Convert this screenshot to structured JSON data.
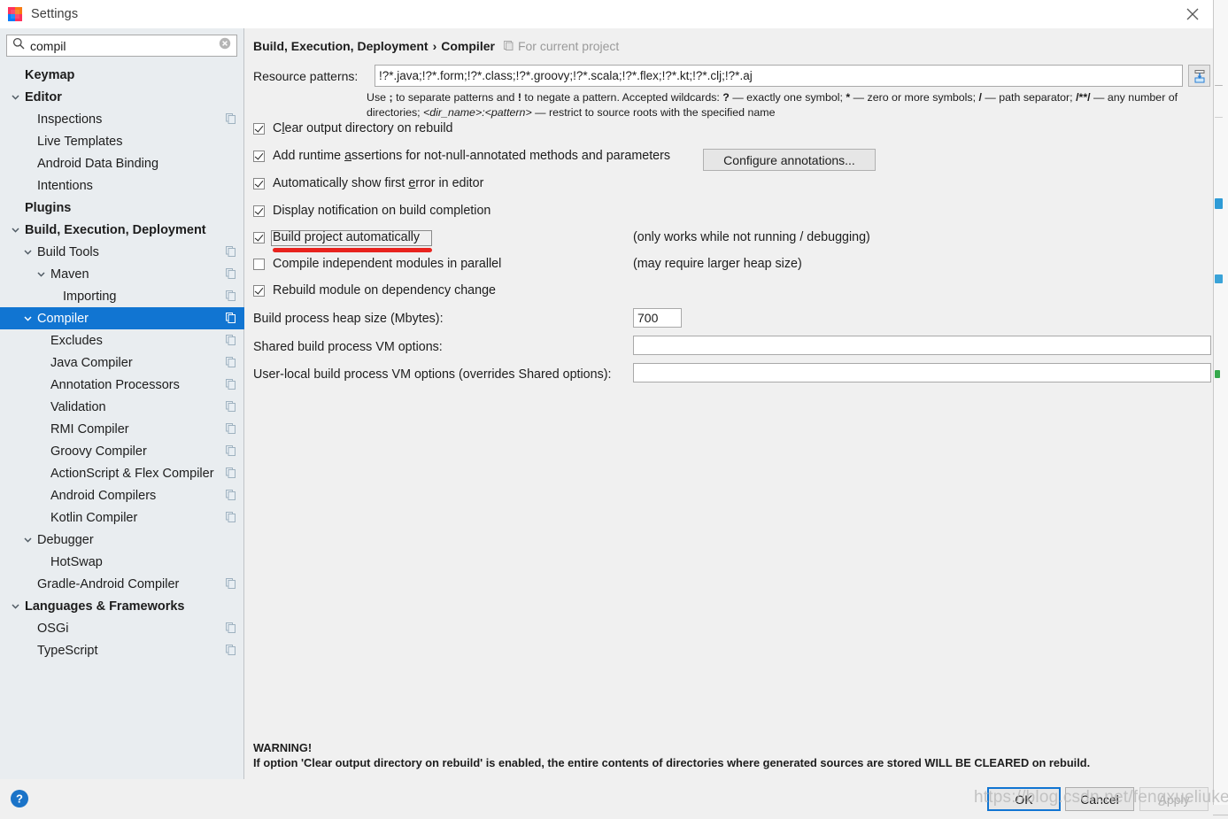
{
  "window": {
    "title": "Settings",
    "app_icon": "intellij-idea-icon",
    "close_icon": "close-icon"
  },
  "search": {
    "icon": "search-icon",
    "value": "compil",
    "placeholder": "",
    "clear_icon": "clear-icon"
  },
  "sidebar": {
    "items": [
      {
        "label": "Keymap",
        "indent": 28,
        "bold": true,
        "twisty": "none",
        "endicon": false,
        "selected": false
      },
      {
        "label": "Editor",
        "indent": 28,
        "bold": true,
        "twisty": "expanded",
        "endicon": false,
        "selected": false
      },
      {
        "label": "Inspections",
        "indent": 42,
        "bold": false,
        "twisty": "none",
        "endicon": true,
        "selected": false
      },
      {
        "label": "Live Templates",
        "indent": 42,
        "bold": false,
        "twisty": "none",
        "endicon": false,
        "selected": false
      },
      {
        "label": "Android Data Binding",
        "indent": 42,
        "bold": false,
        "twisty": "none",
        "endicon": false,
        "selected": false
      },
      {
        "label": "Intentions",
        "indent": 42,
        "bold": false,
        "twisty": "none",
        "endicon": false,
        "selected": false
      },
      {
        "label": "Plugins",
        "indent": 28,
        "bold": true,
        "twisty": "none",
        "endicon": false,
        "selected": false
      },
      {
        "label": "Build, Execution, Deployment",
        "indent": 28,
        "bold": true,
        "twisty": "expanded",
        "endicon": false,
        "selected": false
      },
      {
        "label": "Build Tools",
        "indent": 42,
        "bold": false,
        "twisty": "expanded",
        "endicon": true,
        "selected": false
      },
      {
        "label": "Maven",
        "indent": 57,
        "bold": false,
        "twisty": "expanded",
        "endicon": true,
        "selected": false
      },
      {
        "label": "Importing",
        "indent": 71,
        "bold": false,
        "twisty": "none",
        "endicon": true,
        "selected": false
      },
      {
        "label": "Compiler",
        "indent": 42,
        "bold": false,
        "twisty": "expanded",
        "endicon": true,
        "selected": true
      },
      {
        "label": "Excludes",
        "indent": 57,
        "bold": false,
        "twisty": "none",
        "endicon": true,
        "selected": false
      },
      {
        "label": "Java Compiler",
        "indent": 57,
        "bold": false,
        "twisty": "none",
        "endicon": true,
        "selected": false
      },
      {
        "label": "Annotation Processors",
        "indent": 57,
        "bold": false,
        "twisty": "none",
        "endicon": true,
        "selected": false
      },
      {
        "label": "Validation",
        "indent": 57,
        "bold": false,
        "twisty": "none",
        "endicon": true,
        "selected": false
      },
      {
        "label": "RMI Compiler",
        "indent": 57,
        "bold": false,
        "twisty": "none",
        "endicon": true,
        "selected": false
      },
      {
        "label": "Groovy Compiler",
        "indent": 57,
        "bold": false,
        "twisty": "none",
        "endicon": true,
        "selected": false
      },
      {
        "label": "ActionScript & Flex Compiler",
        "indent": 57,
        "bold": false,
        "twisty": "none",
        "endicon": true,
        "selected": false
      },
      {
        "label": "Android Compilers",
        "indent": 57,
        "bold": false,
        "twisty": "none",
        "endicon": true,
        "selected": false
      },
      {
        "label": "Kotlin Compiler",
        "indent": 57,
        "bold": false,
        "twisty": "none",
        "endicon": true,
        "selected": false
      },
      {
        "label": "Debugger",
        "indent": 42,
        "bold": false,
        "twisty": "expanded",
        "endicon": false,
        "selected": false
      },
      {
        "label": "HotSwap",
        "indent": 57,
        "bold": false,
        "twisty": "none",
        "endicon": false,
        "selected": false
      },
      {
        "label": "Gradle-Android Compiler",
        "indent": 42,
        "bold": false,
        "twisty": "none",
        "endicon": true,
        "selected": false
      },
      {
        "label": "Languages & Frameworks",
        "indent": 28,
        "bold": true,
        "twisty": "expanded",
        "endicon": false,
        "selected": false
      },
      {
        "label": "OSGi",
        "indent": 42,
        "bold": false,
        "twisty": "none",
        "endicon": true,
        "selected": false
      },
      {
        "label": "TypeScript",
        "indent": 42,
        "bold": false,
        "twisty": "none",
        "endicon": true,
        "selected": false
      }
    ]
  },
  "main": {
    "breadcrumb": {
      "parent": "Build, Execution, Deployment",
      "separator": "›",
      "current": "Compiler",
      "scope_icon": "project-scope-icon",
      "scope_label": "For current project"
    },
    "resource_patterns": {
      "label": "Resource patterns:",
      "value": "!?*.java;!?*.form;!?*.class;!?*.groovy;!?*.scala;!?*.flex;!?*.kt;!?*.clj;!?*.aj",
      "placeholder": "",
      "expand_icon": "insert-expand-icon",
      "help_line1_a": "Use ",
      "help_semicolon": ";",
      "help_line1_b": " to separate patterns and ",
      "help_bang": "!",
      "help_line1_c": " to negate a pattern. Accepted wildcards: ",
      "help_q": "?",
      "help_line1_d": " — exactly one symbol; ",
      "help_star": "*",
      "help_line1_e": " — zero or more symbols; ",
      "help_slash": "/",
      "help_line1_f": " — path separator; ",
      "help_globstar": "/**/",
      "help_line1_g": " —",
      "help_line2_a": "any number of directories; ",
      "help_dirname": "<dir_name>",
      "help_colon": ":",
      "help_pattern": "<pattern>",
      "help_line2_b": " — restrict to source roots with the specified name"
    },
    "checkboxes": [
      {
        "label_pre": "C",
        "label_mnemonic": "l",
        "label_post": "ear output directory on rebuild",
        "checked": true,
        "hint": ""
      },
      {
        "label_pre": "Add runtime ",
        "label_mnemonic": "a",
        "label_post": "ssertions for not-null-annotated methods and parameters",
        "checked": true,
        "hint": ""
      },
      {
        "label_pre": "Automatically show first ",
        "label_mnemonic": "e",
        "label_post": "rror in editor",
        "checked": true,
        "hint": ""
      },
      {
        "label_pre": "Display notification on build completion",
        "label_mnemonic": "",
        "label_post": "",
        "checked": true,
        "hint": ""
      },
      {
        "label_pre": "Build project automatically",
        "label_mnemonic": "",
        "label_post": "",
        "checked": true,
        "hint": "(only works while not running / debugging)"
      },
      {
        "label_pre": "Compile independent modules in parallel",
        "label_mnemonic": "",
        "label_post": "",
        "checked": false,
        "hint": "(may require larger heap size)"
      },
      {
        "label_pre": "Rebuild module on dependency change",
        "label_mnemonic": "",
        "label_post": "",
        "checked": true,
        "hint": ""
      }
    ],
    "configure_annotations_button": "Configure annotations...",
    "heap": {
      "label": "Build process heap size (Mbytes):",
      "value": "700"
    },
    "shared_vm": {
      "label": "Shared build process VM options:",
      "value": "",
      "placeholder": ""
    },
    "userlocal_vm": {
      "label": "User-local build process VM options (overrides Shared options):",
      "value": "",
      "placeholder": ""
    },
    "warning": {
      "title": "WARNING!",
      "text": "If option 'Clear output directory on rebuild' is enabled, the entire contents of directories where generated sources are stored WILL BE CLEARED on rebuild."
    },
    "annotation": {
      "highlight_target": "Build project automatically",
      "underline_color": "#e8231e"
    }
  },
  "footer": {
    "help_icon": "help-circle-icon",
    "ok": "OK",
    "cancel": "Cancel",
    "apply": "Apply"
  },
  "watermark": "https://blog.csdn.net/fengxueliuke",
  "colors": {
    "selection_blue": "#1175d2",
    "sidebar_bg": "#e9edf0",
    "dialog_bg": "#f0f0f0",
    "annotation_red": "#e8231e"
  }
}
